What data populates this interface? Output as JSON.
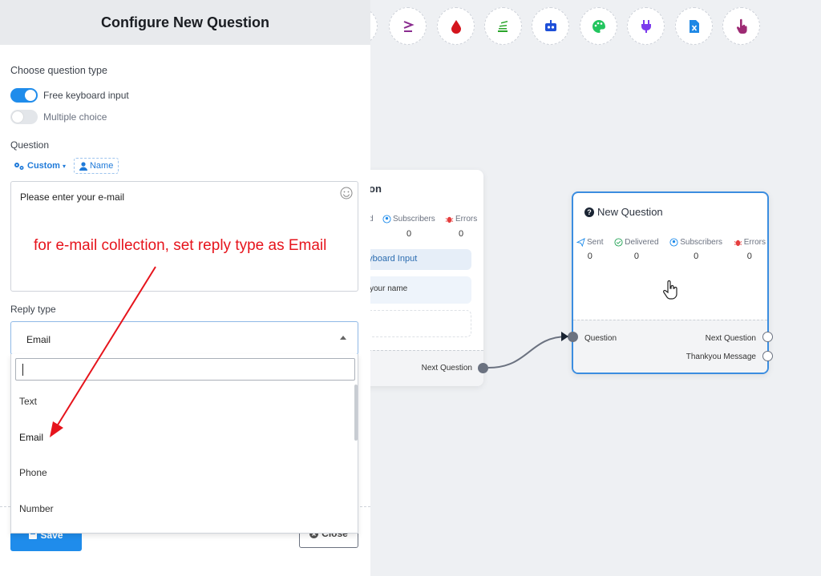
{
  "panel": {
    "title": "Configure New Question",
    "question_type_label": "Choose question type",
    "options": [
      {
        "label": "Free keyboard input",
        "on": true
      },
      {
        "label": "Multiple choice",
        "on": false
      }
    ],
    "question_label": "Question",
    "insert_custom": "Custom",
    "insert_name": "Name",
    "question_text": "Please enter your e-mail",
    "reply_type_label": "Reply type",
    "reply_type_value": "Email",
    "dropdown_items": [
      "Text",
      "Email",
      "Phone",
      "Number"
    ],
    "save_label": "Save",
    "close_label": "Close"
  },
  "annotation": {
    "text": "for e-mail collection, set reply type as Email",
    "color": "#e6141c"
  },
  "toolbar_icons": [
    "greater-equal-icon",
    "drop-icon",
    "stack-icon",
    "robot-icon",
    "palette-icon",
    "plug-icon",
    "file-excel-icon",
    "hand-pointer-icon"
  ],
  "left_card": {
    "title_fragment": "on",
    "stat_fragment": "d",
    "subscribers_label": "Subscribers",
    "errors_label": "Errors",
    "subscribers_value": "0",
    "errors_value": "0",
    "option1": "eyboard Input",
    "option2": "your name",
    "next_question": "Next Question"
  },
  "new_card": {
    "title": "New Question",
    "stats": [
      {
        "label": "Sent",
        "value": "0"
      },
      {
        "label": "Delivered",
        "value": "0"
      },
      {
        "label": "Subscribers",
        "value": "0"
      },
      {
        "label": "Errors",
        "value": "0"
      }
    ],
    "in_port": "Question",
    "out_port_1": "Next Question",
    "out_port_2": "Thankyou Message"
  },
  "colors": {
    "accent": "#1f8ceb",
    "card_border": "#3b8de0",
    "annotation": "#e6141c"
  }
}
